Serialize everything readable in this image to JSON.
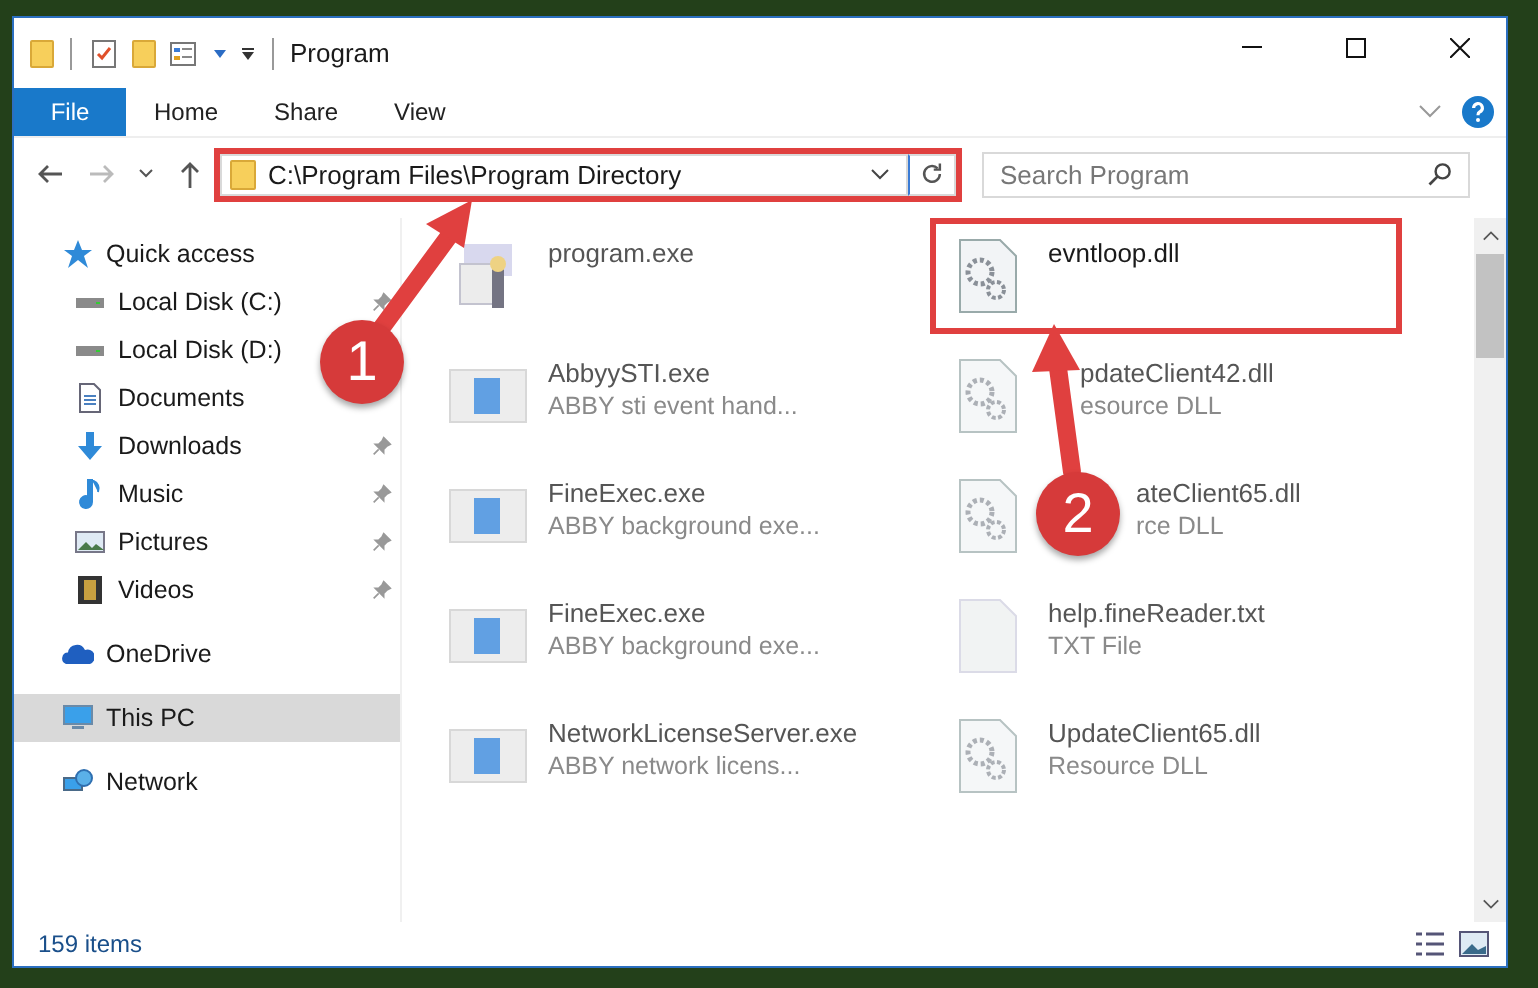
{
  "window": {
    "title": "Program"
  },
  "ribbon_tabs": [
    {
      "label": "File",
      "kind": "file"
    },
    {
      "label": "Home",
      "kind": "tab"
    },
    {
      "label": "Share",
      "kind": "tab"
    },
    {
      "label": "View",
      "kind": "tab"
    }
  ],
  "address": {
    "value": "C:\\Program Files\\Program Directory",
    "highlighted": true
  },
  "search": {
    "placeholder": "Search Program"
  },
  "nav": [
    {
      "label": "Quick access",
      "kind": "star",
      "selected": false,
      "children": [
        {
          "label": "Local Disk (C:)",
          "kind": "disk",
          "pinned": true,
          "selected": false
        },
        {
          "label": "Local Disk (D:)",
          "kind": "disk",
          "pinned": false,
          "selected": false
        },
        {
          "label": "Documents",
          "kind": "docs",
          "pinned": false,
          "selected": false
        },
        {
          "label": "Downloads",
          "kind": "down",
          "pinned": true,
          "selected": false
        },
        {
          "label": "Music",
          "kind": "music",
          "pinned": true,
          "selected": false
        },
        {
          "label": "Pictures",
          "kind": "pics",
          "pinned": true,
          "selected": false
        },
        {
          "label": "Videos",
          "kind": "video",
          "pinned": true,
          "selected": false
        }
      ]
    },
    {
      "label": "OneDrive",
      "kind": "cloud",
      "selected": false
    },
    {
      "label": "This PC",
      "kind": "pc",
      "selected": true
    },
    {
      "label": "Network",
      "kind": "net",
      "selected": false
    }
  ],
  "files": [
    {
      "name": "program.exe",
      "kind": "program",
      "blurred": true,
      "highlighted": false
    },
    {
      "name": "evntloop.dll",
      "kind": "dll",
      "blurred": false,
      "highlighted": true
    },
    {
      "name": "AbbyySTI.exe",
      "description": "ABBY sti event hand...",
      "kind": "app",
      "blurred": true,
      "highlighted": false
    },
    {
      "name": "pdateClient42.dll",
      "description": "esource DLL",
      "kind": "dll",
      "blurred": true,
      "highlighted": false
    },
    {
      "name": "FineExec.exe",
      "description": "ABBY background exe...",
      "kind": "app",
      "blurred": true,
      "highlighted": false
    },
    {
      "name": "ateClient65.dll",
      "description": "rce DLL",
      "kind": "dll",
      "blurred": true,
      "highlighted": false
    },
    {
      "name": "FineExec.exe",
      "description": "ABBY background exe...",
      "kind": "app",
      "blurred": true,
      "highlighted": false
    },
    {
      "name": "help.fineReader.txt",
      "description": "TXT File",
      "kind": "txt",
      "blurred": true,
      "highlighted": false
    },
    {
      "name": "NetworkLicenseServer.exe",
      "description": "ABBY network licens...",
      "kind": "app",
      "blurred": true,
      "highlighted": false
    },
    {
      "name": "UpdateClient65.dll",
      "description": "Resource DLL",
      "kind": "dll",
      "blurred": true,
      "highlighted": false
    }
  ],
  "status_bar": {
    "count": "159 items"
  },
  "callouts": [
    {
      "number": "1"
    },
    {
      "number": "2"
    }
  ]
}
